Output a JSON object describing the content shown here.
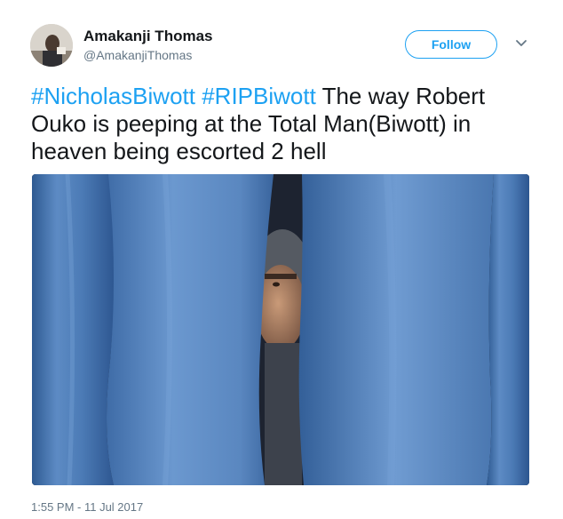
{
  "author": {
    "name": "Amakanji Thomas",
    "handle": "@AmakanjiThomas"
  },
  "follow_button": {
    "label": "Follow"
  },
  "tweet": {
    "hashtag1": "#NicholasBiwott",
    "hashtag2": "#RIPBiwott",
    "text": "The way Robert Ouko is peeping at the Total Man(Biwott) in heaven being escorted 2 hell"
  },
  "timestamp": "1:55 PM - 11 Jul 2017",
  "colors": {
    "accent": "#1da1f2",
    "text": "#14171a",
    "secondary": "#657786"
  },
  "icons": [
    "avatar-photo",
    "chevron-down-icon"
  ]
}
